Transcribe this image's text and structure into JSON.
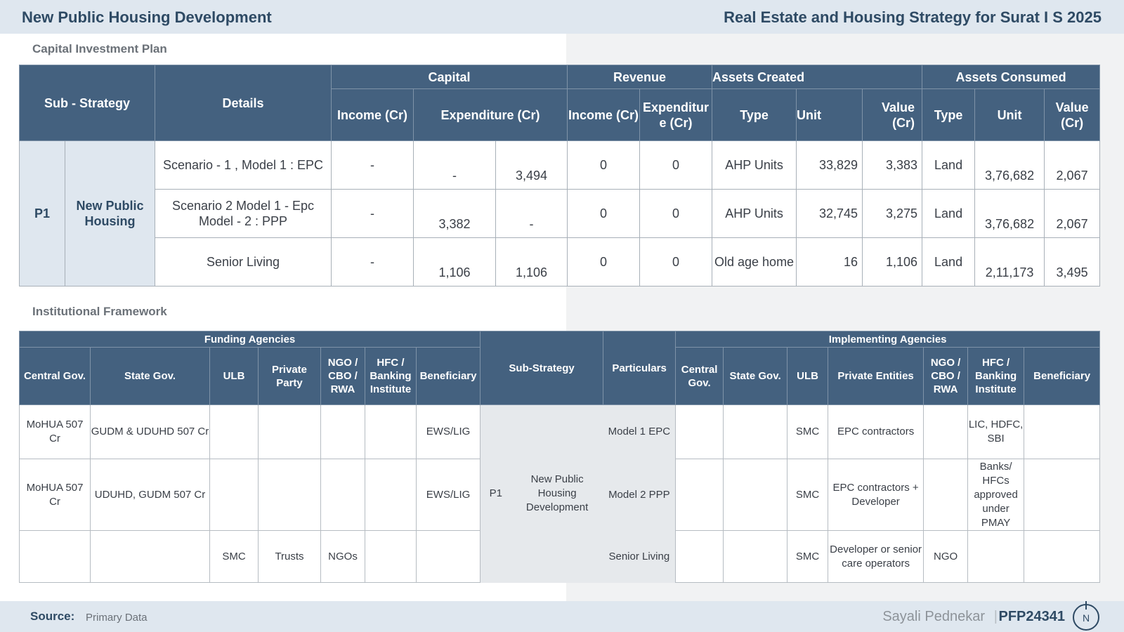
{
  "header": {
    "left_title": "New Public Housing Development",
    "right_title": "Real Estate and Housing Strategy for Surat I S 2025"
  },
  "capital_plan": {
    "label": "Capital Investment Plan",
    "headers": {
      "sub_strategy": "Sub - Strategy",
      "details": "Details",
      "capital": "Capital",
      "revenue": "Revenue",
      "assets_created": "Assets Created",
      "assets_consumed": "Assets Consumed",
      "income_cr": "Income (Cr)",
      "expenditure_cr": "Expenditure (Cr)",
      "rev_income": "Income (Cr)",
      "rev_expenditure": "Expenditur e (Cr)",
      "type": "Type",
      "unit": "Unit",
      "value": "Value (Cr)",
      "consumed_type": "Type",
      "consumed_unit": "Unit",
      "consumed_value": "Value (Cr)"
    },
    "p_code": "P1",
    "strategy_name": "New Public Housing",
    "rows": [
      {
        "details": "Scenario - 1 , Model 1 : EPC",
        "income": "-",
        "exp_a": "-",
        "exp_b": "3,494",
        "rev_income": "0",
        "rev_exp": "0",
        "type": "AHP Units",
        "unit": "33,829",
        "value": "3,383",
        "c_type": "Land",
        "c_unit": "3,76,682",
        "c_value": "2,067"
      },
      {
        "details": "Scenario 2 Model 1 - Epc Model - 2 :  PPP",
        "income": "-",
        "exp_a": "3,382",
        "exp_b": "-",
        "rev_income": "0",
        "rev_exp": "0",
        "type": "AHP Units",
        "unit": "32,745",
        "value": "3,275",
        "c_type": "Land",
        "c_unit": "3,76,682",
        "c_value": "2,067"
      },
      {
        "details": "Senior Living",
        "income": "-",
        "exp_a": "1,106",
        "exp_b": "1,106",
        "rev_income": "0",
        "rev_exp": "0",
        "type": "Old age home",
        "unit": "16",
        "value": "1,106",
        "c_type": "Land",
        "c_unit": "2,11,173",
        "c_value": "3,495"
      }
    ]
  },
  "framework": {
    "label": "Institutional Framework",
    "headers": {
      "funding": "Funding Agencies",
      "implementing": "Implementing Agencies",
      "central": "Central Gov.",
      "state": "State Gov.",
      "ulb": "ULB",
      "private_party": "Private Party",
      "ngo": "NGO / CBO / RWA",
      "hfc": "HFC / Banking Institute",
      "beneficiary": "Beneficiary",
      "sub_strategy": "Sub-Strategy",
      "particulars": "Particulars",
      "impl_central": "Central Gov.",
      "impl_state": "State Gov.",
      "impl_ulb": "ULB",
      "private_entities": "Private Entities",
      "impl_ngo": "NGO / CBO / RWA",
      "impl_hfc": "HFC / Banking Institute",
      "impl_beneficiary": "Beneficiary"
    },
    "p_code": "P1",
    "strategy_name": "New Public Housing Development",
    "rows": [
      {
        "central": "MoHUA 507 Cr",
        "state": "GUDM & UDUHD 507 Cr",
        "ulb": "",
        "private_party": "",
        "ngo": "",
        "hfc": "",
        "beneficiary": "EWS/LIG",
        "particulars": "Model 1 EPC",
        "i_central": "",
        "i_state": "",
        "i_ulb": "SMC",
        "i_private": "EPC contractors",
        "i_ngo": "",
        "i_hfc": "LIC, HDFC, SBI",
        "i_beneficiary": ""
      },
      {
        "central": "MoHUA 507 Cr",
        "state": "UDUHD, GUDM 507 Cr",
        "ulb": "",
        "private_party": "",
        "ngo": "",
        "hfc": "",
        "beneficiary": "EWS/LIG",
        "particulars": "Model 2 PPP",
        "i_central": "",
        "i_state": "",
        "i_ulb": "SMC",
        "i_private": "EPC contractors + Developer",
        "i_ngo": "",
        "i_hfc": "Banks/ HFCs approved under PMAY",
        "i_beneficiary": ""
      },
      {
        "central": "",
        "state": "",
        "ulb": "SMC",
        "private_party": "Trusts",
        "ngo": "NGOs",
        "hfc": "",
        "beneficiary": "",
        "particulars": "Senior Living",
        "i_central": "",
        "i_state": "",
        "i_ulb": "SMC",
        "i_private": "Developer or senior care operators",
        "i_ngo": "NGO",
        "i_hfc": "",
        "i_beneficiary": ""
      }
    ]
  },
  "footer": {
    "source_label": "Source:",
    "source_value": "Primary Data",
    "author": "Sayali Pednekar",
    "separator": "|",
    "code": "PFP24341",
    "logo_letter": "N"
  }
}
